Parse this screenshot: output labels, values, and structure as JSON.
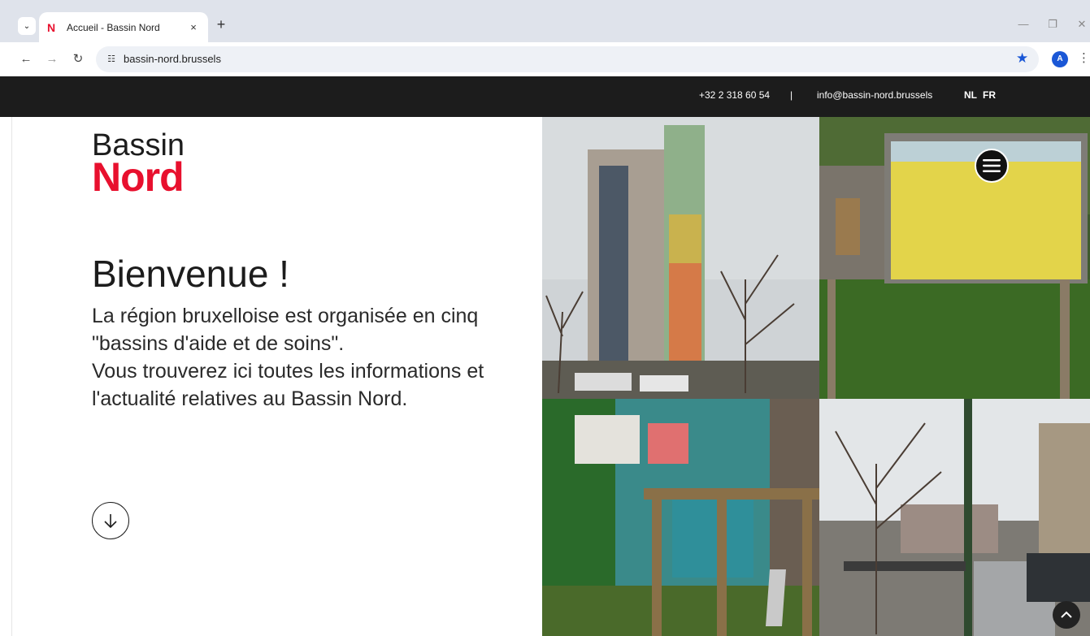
{
  "browser": {
    "tab_title": "Accueil - Bassin Nord",
    "tab_favicon": "N",
    "url": "bassin-nord.brussels",
    "avatar_initial": "A",
    "tab_search_icon": "chevron-down-icon",
    "new_tab_symbol": "+",
    "close_symbol": "×"
  },
  "topbar": {
    "phone": "+32 2 318 60 54",
    "separator": "|",
    "email": "info@bassin-nord.brussels",
    "lang_nl": "NL",
    "lang_fr": "FR"
  },
  "logo": {
    "line1": "Bassin",
    "line2": "Nord"
  },
  "hero": {
    "heading": "Bienvenue !",
    "paragraph_1": "La région bruxelloise est organisée en cinq \"bassins d'aide et de soins\".",
    "paragraph_2": "Vous trouverez ici toutes les informations et l'actualité relatives au Bassin Nord."
  },
  "colors": {
    "brand_red": "#e8102e",
    "topbar_bg": "#1c1c1c",
    "chrome_bg": "#dfe3eb",
    "accent_blue": "#1a57d6"
  }
}
